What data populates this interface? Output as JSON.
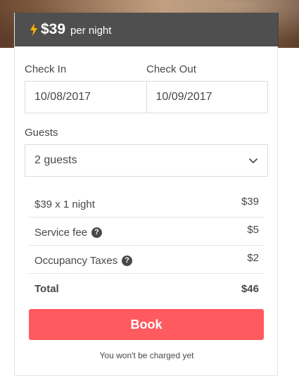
{
  "price": {
    "amount": "$39",
    "unit": "per night",
    "icon": "lightning-bolt-icon",
    "icon_color": "#ffb400"
  },
  "dates": {
    "check_in_label": "Check In",
    "check_out_label": "Check Out",
    "check_in_value": "10/08/2017",
    "check_out_value": "10/09/2017"
  },
  "guests": {
    "label": "Guests",
    "selected": "2 guests"
  },
  "summary": {
    "rows": [
      {
        "label": "$39 x 1 night",
        "value": "$39"
      },
      {
        "label": "Service fee",
        "value": "$5",
        "help": "?"
      },
      {
        "label": "Occupancy Taxes",
        "value": "$2",
        "help": "?"
      },
      {
        "label": "Total",
        "value": "$46"
      }
    ]
  },
  "book": {
    "label": "Book",
    "color": "#ff5a5f"
  },
  "note": "You won't be charged yet"
}
